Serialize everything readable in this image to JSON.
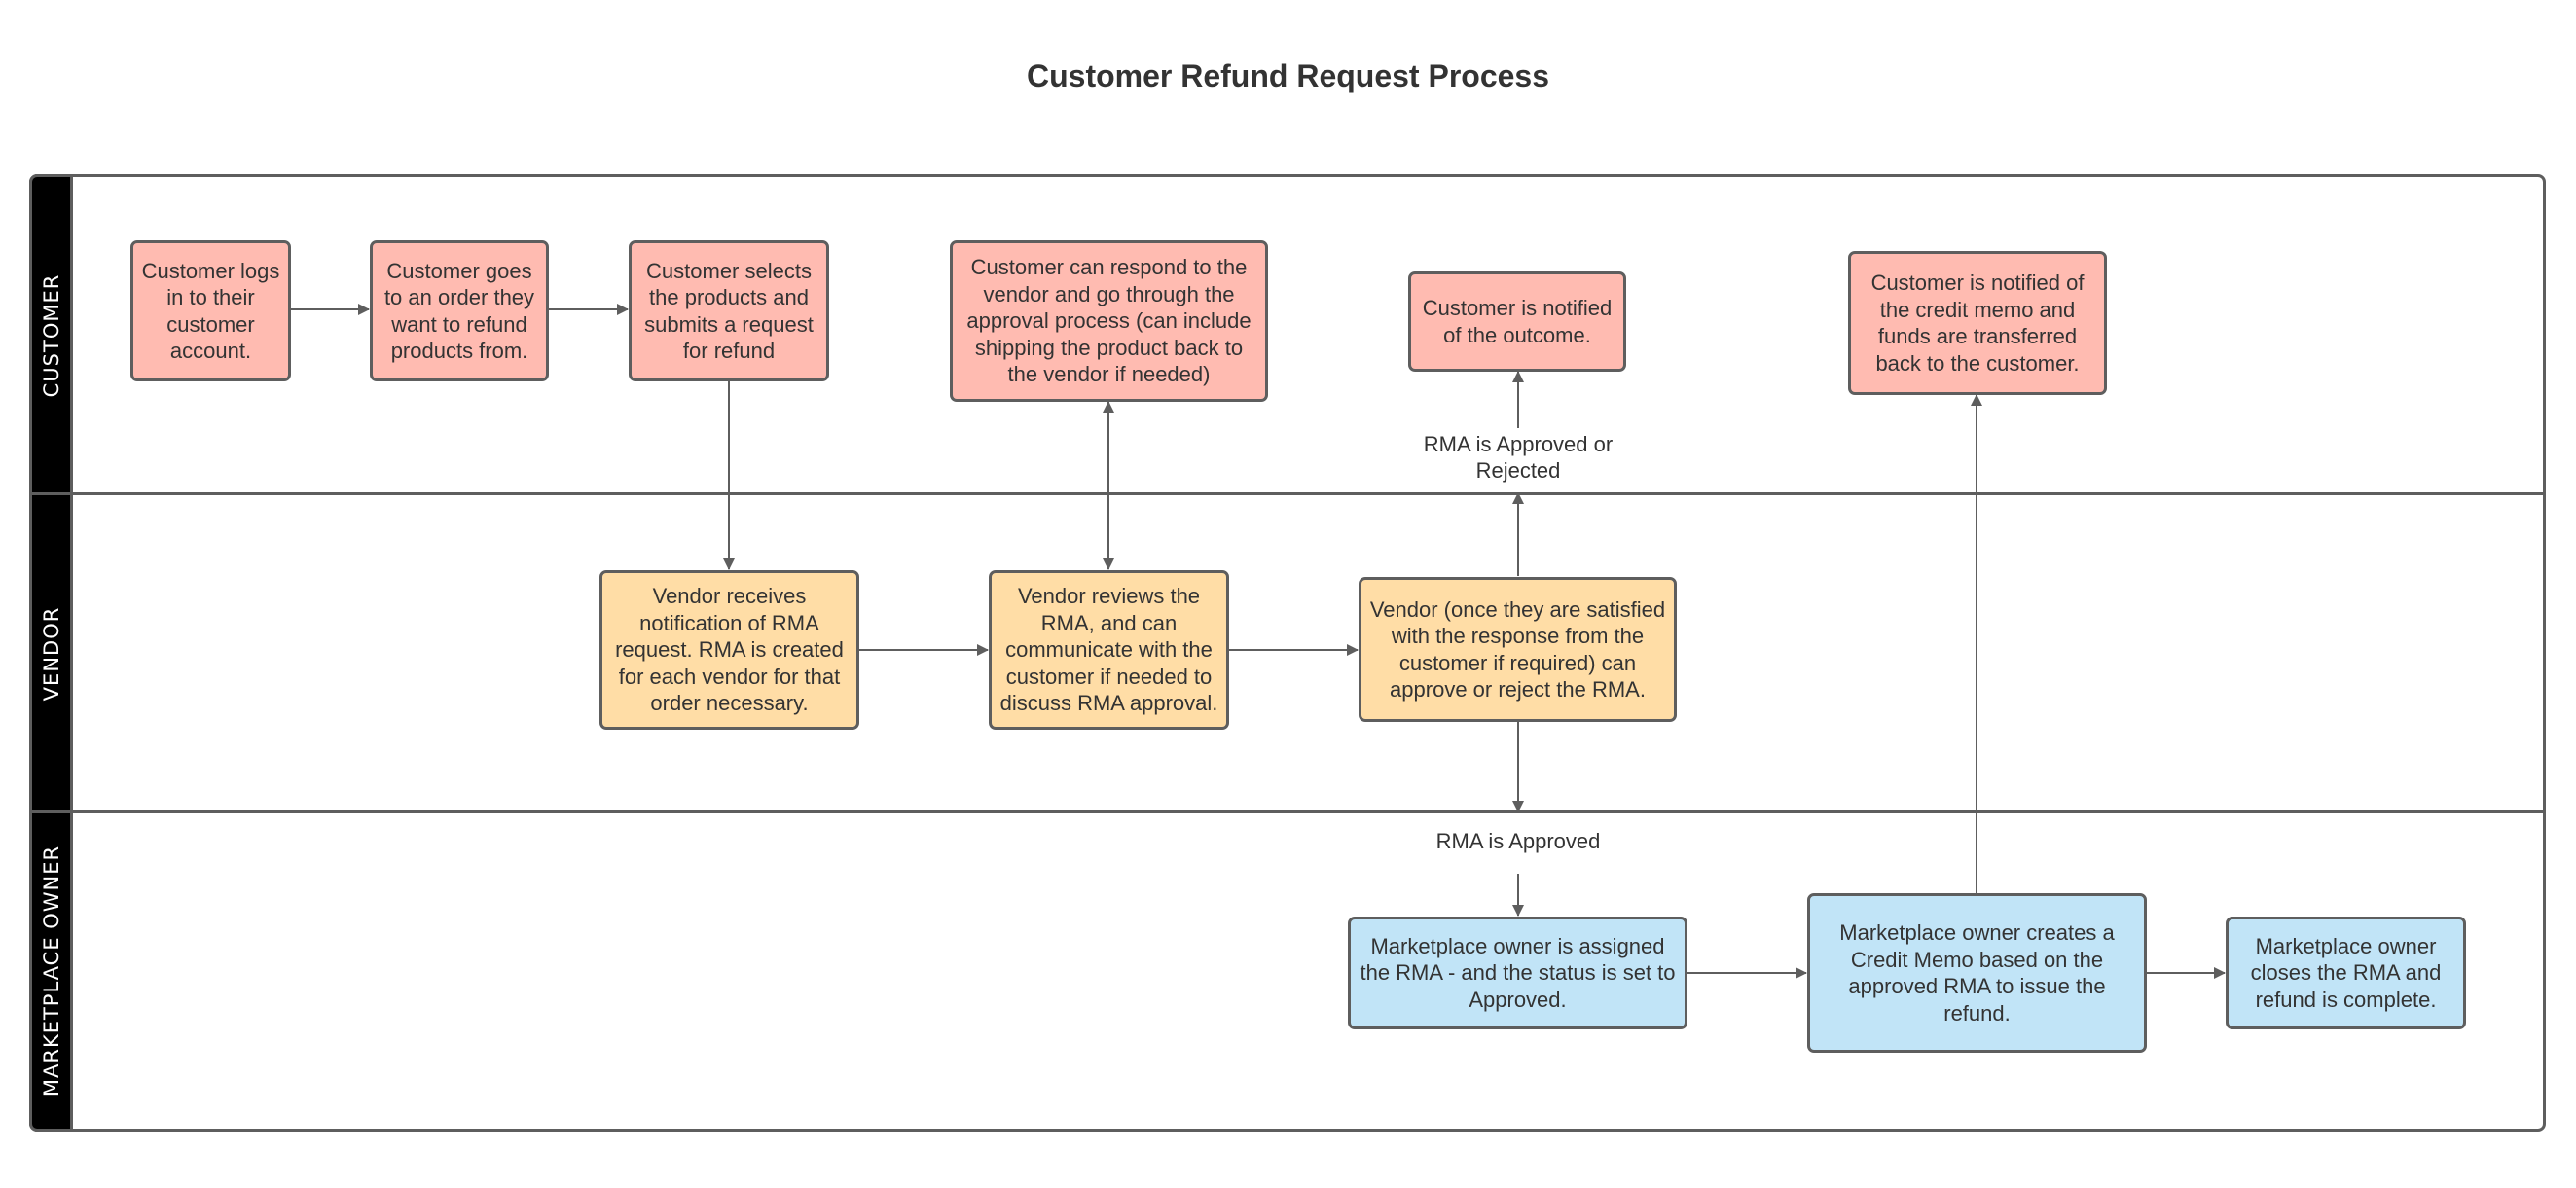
{
  "title": "Customer Refund Request Process",
  "colors": {
    "customer_fill": "#ffbbb1",
    "vendor_fill": "#ffdda6",
    "owner_fill": "#c1e4f7",
    "stroke": "#5e5e5e",
    "lane_header": "#000000",
    "text": "#333333"
  },
  "lanes": [
    {
      "id": "customer",
      "label": "CUSTOMER"
    },
    {
      "id": "vendor",
      "label": "VENDOR"
    },
    {
      "id": "owner",
      "label": "MARKETPLACE OWNER"
    }
  ],
  "nodes": {
    "c1": {
      "lane": "customer",
      "text": "Customer logs in to their customer account."
    },
    "c2": {
      "lane": "customer",
      "text": "Customer goes to an order they want to refund products from."
    },
    "c3": {
      "lane": "customer",
      "text": "Customer selects the products and submits a request for refund"
    },
    "c4": {
      "lane": "customer",
      "text": "Customer can respond to the vendor and go through the approval process (can include shipping the product back to the vendor if needed)"
    },
    "c5": {
      "lane": "customer",
      "text": "Customer is notified of the outcome."
    },
    "c6": {
      "lane": "customer",
      "text": "Customer is notified of the credit memo and funds are transferred back to the customer."
    },
    "v1": {
      "lane": "vendor",
      "text": "Vendor receives notification of RMA request. RMA is created for each vendor for that order necessary."
    },
    "v2": {
      "lane": "vendor",
      "text": "Vendor reviews the RMA, and can communicate with the customer if needed to discuss RMA approval."
    },
    "v3": {
      "lane": "vendor",
      "text": "Vendor (once they are satisfied with the response from the customer if required) can approve or reject the RMA."
    },
    "m1": {
      "lane": "owner",
      "text": "Marketplace owner is assigned the RMA - and the status is set to Approved."
    },
    "m2": {
      "lane": "owner",
      "text": "Marketplace owner creates a Credit Memo based on the approved RMA to issue the refund."
    },
    "m3": {
      "lane": "owner",
      "text": "Marketplace owner closes the RMA and refund is complete."
    }
  },
  "edges": [
    {
      "from": "c1",
      "to": "c2"
    },
    {
      "from": "c2",
      "to": "c3"
    },
    {
      "from": "c3",
      "to": "v1"
    },
    {
      "from": "v1",
      "to": "v2"
    },
    {
      "from": "v2",
      "to": "c4",
      "bidirectional": true
    },
    {
      "from": "v2",
      "to": "v3"
    },
    {
      "from": "v3",
      "to": "c5",
      "label": "RMA is Approved or Rejected"
    },
    {
      "from": "v3",
      "to": "m1",
      "label": "RMA is Approved"
    },
    {
      "from": "m1",
      "to": "m2"
    },
    {
      "from": "m2",
      "to": "m3"
    },
    {
      "from": "m2",
      "to": "c6"
    }
  ],
  "edge_labels": {
    "approved_or_rejected": "RMA is Approved or Rejected",
    "approved": "RMA is Approved"
  }
}
